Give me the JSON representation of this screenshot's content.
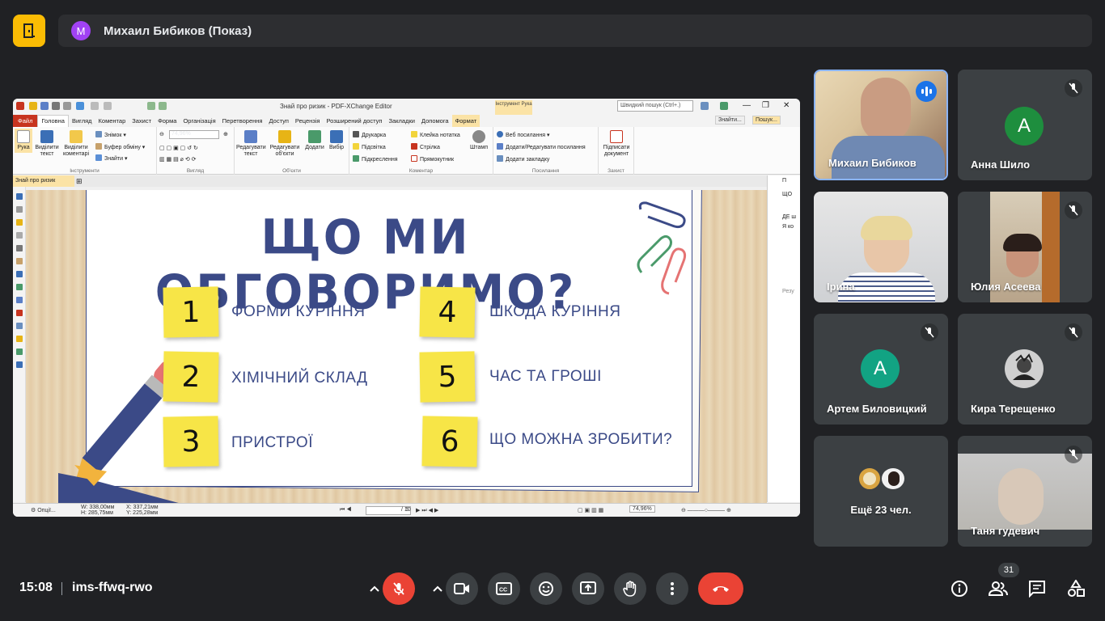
{
  "presenter": {
    "initial": "M",
    "label": "Михаил Бибиков (Показ)"
  },
  "app": {
    "title": "Знай про ризик - PDF-XChange Editor",
    "search_placeholder": "Швидкий пошук (Ctrl+.)",
    "tool_context": "Інструмент Рука",
    "menu": [
      "Файл",
      "Головна",
      "Вигляд",
      "Коментар",
      "Захист",
      "Форма",
      "Організація",
      "Перетворення",
      "Доступ",
      "Рецензія",
      "Розширений доступ",
      "Закладки",
      "Допомога",
      "Формат"
    ],
    "right_menu": [
      "Знайти...",
      "Пошук..."
    ],
    "ribbon": {
      "tools": {
        "hand": "Рука",
        "select_text": "Виділити текст",
        "select_comments": "Виділити коментарі",
        "snapshot": "Знімок",
        "clipboard": "Буфер обміну",
        "find": "Знайти",
        "group": "Інструменти"
      },
      "view": {
        "zoom": "74,96%",
        "group": "Вигляд"
      },
      "objects": {
        "edit_text": "Редагувати текст",
        "edit_objects": "Редагувати об'єкти",
        "add": "Додати",
        "select": "Вибір",
        "group": "Об'єкти"
      },
      "comment": {
        "typewriter": "Друкарка",
        "highlight": "Підсвітка",
        "underline": "Підкреслення",
        "sticky": "Клейка нотатка",
        "arrow": "Стрілка",
        "rect": "Прямокутник",
        "stamp": "Штамп",
        "group": "Коментар"
      },
      "links": {
        "web": "Веб посилання",
        "addedit": "Додати/Редагувати посилання",
        "bookmark": "Додати закладку",
        "group": "Посилання"
      },
      "protect": {
        "sign": "Підписати документ",
        "group": "Захист"
      }
    },
    "doc_tab": "Знай про ризик",
    "slide": {
      "title": "ЩО МИ ОБГОВОРИМО?",
      "items": [
        {
          "num": "1",
          "text": "ФОРМИ КУРІННЯ"
        },
        {
          "num": "2",
          "text": "ХІМІЧНИЙ СКЛАД"
        },
        {
          "num": "3",
          "text": "ПРИСТРОЇ"
        },
        {
          "num": "4",
          "text": "ШКОДА КУРІННЯ"
        },
        {
          "num": "5",
          "text": "ЧАС ТА ГРОШІ"
        },
        {
          "num": "6",
          "text": "ЩО МОЖНА ЗРОБИТИ?"
        }
      ]
    },
    "right_panel": [
      "П",
      "ЩО",
      "ДЕ ш",
      "Я ко",
      "Резу"
    ],
    "status": {
      "options": "Опції...",
      "width": "W: 338,00мм",
      "height": "H: 285,75мм",
      "x": "X: 337,21мм",
      "y": "Y: 225,28мм",
      "page": "5",
      "pages": "/ 10",
      "zoom": "74,96%"
    }
  },
  "participants": [
    {
      "name": "Михаил Бибиков",
      "type": "video",
      "speaking": true
    },
    {
      "name": "Анна Шило",
      "type": "avatar",
      "initial": "A",
      "color": "#1e8e3e",
      "muted": true
    },
    {
      "name": "Ірина",
      "type": "video",
      "muted": false
    },
    {
      "name": "Юлия Асеева",
      "type": "video",
      "muted": true
    },
    {
      "name": "Артем Биловицкий",
      "type": "avatar",
      "initial": "A",
      "color": "#12a383",
      "muted": true
    },
    {
      "name": "Кира Терещенко",
      "type": "image",
      "muted": true
    },
    {
      "name": "Ещё 23 чел.",
      "type": "more"
    },
    {
      "name": "Таня гудевич",
      "type": "video",
      "muted": true
    }
  ],
  "bottom": {
    "time": "15:08",
    "meeting_code": "ims-ffwq-rwo",
    "people_count": "31"
  },
  "colors": {
    "leave": "#ea4335",
    "mic_off": "#ea4335",
    "tile": "#3c4043",
    "background": "#202124",
    "slide_text": "#3b4a87",
    "note": "#f7e547"
  }
}
